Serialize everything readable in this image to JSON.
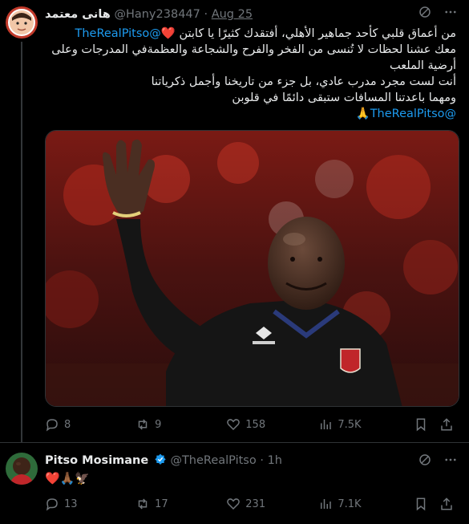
{
  "tweet1": {
    "display_name": "هانى معتمد",
    "handle": "@Hany238447",
    "separator": "·",
    "time": "Aug 25",
    "mention_inline": "@TheRealPitso",
    "line1_text": " أفتقدك كثيرًا يا كابتن ",
    "line1_prefix": "من أعماق قلبي كأحد جماهير الأهلي،",
    "line2": "معك عشنا لحظات لا تُنسى من الفخر والفرح والشجاعة والعظمةفي المدرجات وعلى",
    "line3": "أرضية الملعب",
    "line4": "أنت لست مجرد مدرب عادي، بل جزء من تاريخنا وأجمل ذكرياتنا",
    "line5": "ومهما باعدتنا المسافات ستبقى دائمًا في قلوبن",
    "line6_mention": "@TheRealPitso",
    "heart_emoji": "❤️",
    "pray_emoji": "🙏",
    "stats": {
      "replies": "8",
      "reposts": "9",
      "likes": "158",
      "views": "7.5K"
    }
  },
  "tweet2": {
    "display_name": "Pitso Mosimane",
    "handle": "@TheRealPitso",
    "separator": "·",
    "time": "1h",
    "emoji_text": "❤️🙏🏾🦅",
    "stats": {
      "replies": "13",
      "reposts": "17",
      "likes": "231",
      "views": "7.1K"
    }
  },
  "colors": {
    "accent": "#1d9bf0",
    "muted": "#71767b",
    "verified": "#1d9bf0",
    "heart": "#f91880"
  },
  "icons": [
    "grok-icon",
    "more-icon",
    "reply-icon",
    "repost-icon",
    "like-icon",
    "views-icon",
    "bookmark-icon",
    "share-icon",
    "verified-badge-icon"
  ]
}
